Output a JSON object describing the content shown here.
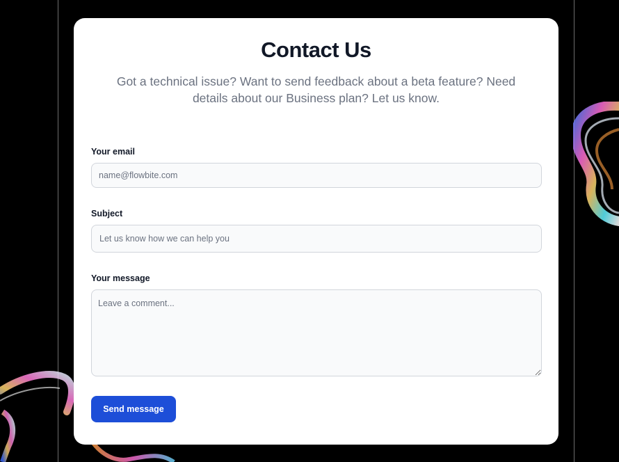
{
  "contact": {
    "title": "Contact Us",
    "subtitle": "Got a technical issue? Want to send feedback about a beta feature? Need details about our Business plan? Let us know."
  },
  "form": {
    "email": {
      "label": "Your email",
      "placeholder": "name@flowbite.com",
      "value": ""
    },
    "subject": {
      "label": "Subject",
      "placeholder": "Let us know how we can help you",
      "value": ""
    },
    "message": {
      "label": "Your message",
      "placeholder": "Leave a comment...",
      "value": ""
    },
    "submit_label": "Send message"
  },
  "colors": {
    "page_background": "#000000",
    "card_background": "#ffffff",
    "heading": "#111827",
    "muted_text": "#6b7280",
    "field_background": "#f9fafb",
    "field_border": "#d1d5db",
    "primary_button": "#1d4ed8"
  },
  "decorations": {
    "right_edge": "iridescent-ribbon",
    "bottom_left": "iridescent-ribbon",
    "bottom_center": "iridescent-ribbon"
  }
}
